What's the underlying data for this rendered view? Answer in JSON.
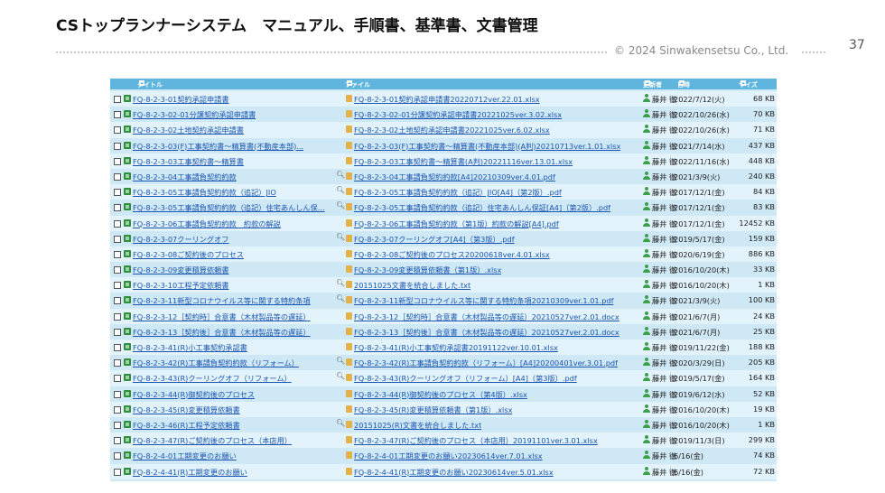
{
  "slide": {
    "title": "CSトップランナーシステム　マニュアル、手順書、基準書、文書管理",
    "copyright": "© 2024 Sinwakensetsu Co., Ltd.",
    "page_number": "37"
  },
  "table": {
    "headers": {
      "title": "タイトル",
      "file": "ファイル",
      "updater": "更新者",
      "date": "日時",
      "size": "サイズ"
    },
    "rows": [
      {
        "title": "FQ-8-2-3-01契約承認申請書",
        "file": "FQ-8-2-3-01契約承認申請書20220712ver.22.01.xlsx",
        "user": "藤井 徹",
        "date": "2022/7/12(火)",
        "size": "68 KB",
        "preview": false
      },
      {
        "title": "FQ-8-2-3-02-01分譲契約承認申請書",
        "file": "FQ-8-2-3-02-01分譲契約承認申請書20221025ver.3.02.xlsx",
        "user": "藤井 徹",
        "date": "2022/10/26(水)",
        "size": "70 KB",
        "preview": false
      },
      {
        "title": "FQ-8-2-3-02土地契約承認申請書",
        "file": "FQ-8-2-3-02土地契約承認申請書20221025ver.6.02.xlsx",
        "user": "藤井 徹",
        "date": "2022/10/26(水)",
        "size": "71 KB",
        "preview": false
      },
      {
        "title": "FQ-8-2-3-03(F)工事契約書～精算書(不動産本部)...",
        "file": "FQ-8-2-3-03(F)工事契約書～精算書(不動産本部)(A判)20210713ver.1.01.xlsx",
        "user": "藤井 徹",
        "date": "2021/7/14(水)",
        "size": "437 KB",
        "preview": false
      },
      {
        "title": "FQ-8-2-3-03工事契約書～精算書",
        "file": "FQ-8-2-3-03工事契約書～精算書(A判)20221116ver.13.01.xlsx",
        "user": "藤井 徹",
        "date": "2022/11/16(水)",
        "size": "448 KB",
        "preview": false
      },
      {
        "title": "FQ-8-2-3-04工事請負契約約款",
        "file": "FQ-8-2-3-04工事請負契約約款[A4]20210309ver.4.01.pdf",
        "user": "藤井 徹",
        "date": "2021/3/9(火)",
        "size": "240 KB",
        "preview": true
      },
      {
        "title": "FQ-8-2-3-05工事請負契約約款（追記）JIO",
        "file": "FQ-8-2-3-05工事請負契約約款（追記）JIO[A4]（第2版）.pdf",
        "user": "藤井 徹",
        "date": "2017/12/1(金)",
        "size": "84 KB",
        "preview": true
      },
      {
        "title": "FQ-8-2-3-05工事請負契約約款（追記）住宅あんしん保...",
        "file": "FQ-8-2-3-05工事請負契約約款（追記）住宅あんしん保証[A4]（第2版）.pdf",
        "user": "藤井 徹",
        "date": "2017/12/1(金)",
        "size": "83 KB",
        "preview": true
      },
      {
        "title": "FQ-8-2-3-06工事請負契約約款　約款の解説",
        "file": "FQ-8-2-3-06工事請負契約約款（第1版）約款の解説[A4].pdf",
        "user": "藤井 徹",
        "date": "2017/12/1(金)",
        "size": "12452 KB",
        "preview": false
      },
      {
        "title": "FQ-8-2-3-07クーリングオフ",
        "file": "FQ-8-2-3-07クーリングオフ[A4]（第3版）.pdf",
        "user": "藤井 徹",
        "date": "2019/5/17(金)",
        "size": "159 KB",
        "preview": true
      },
      {
        "title": "FQ-8-2-3-08ご契約後のプロセス",
        "file": "FQ-8-2-3-08ご契約後のプロセス20200618ver.4.01.xlsx",
        "user": "藤井 徹",
        "date": "2020/6/19(金)",
        "size": "886 KB",
        "preview": false
      },
      {
        "title": "FQ-8-2-3-09変更積算依頼書",
        "file": "FQ-8-2-3-09変更積算依頼書（第1版）.xlsx",
        "user": "藤井 徹",
        "date": "2016/10/20(木)",
        "size": "33 KB",
        "preview": false
      },
      {
        "title": "FQ-8-2-3-10工程予定依頼書",
        "file": "20151025文書を統合しました.txt",
        "user": "藤井 徹",
        "date": "2016/10/20(木)",
        "size": "1 KB",
        "preview": true
      },
      {
        "title": "FQ-8-2-3-11新型コロナウイルス等に関する特約条項",
        "file": "FQ-8-2-3-11新型コロナウイルス等に関する特約条項20210309ver.1.01.pdf",
        "user": "藤井 徹",
        "date": "2021/3/9(火)",
        "size": "100 KB",
        "preview": true
      },
      {
        "title": "FQ-8-2-3-12［契約時］合意書（木材製品等の遅延）",
        "file": "FQ-8-2-3-12［契約時］合意書（木材製品等の遅延）20210527ver.2.01.docx",
        "user": "藤井 徹",
        "date": "2021/6/7(月)",
        "size": "24 KB",
        "preview": false
      },
      {
        "title": "FQ-8-2-3-13［契約後］合意書（木材製品等の遅延）",
        "file": "FQ-8-2-3-13［契約後］合意書（木材製品等の遅延）20210527ver.2.01.docx",
        "user": "藤井 徹",
        "date": "2021/6/7(月)",
        "size": "25 KB",
        "preview": false
      },
      {
        "title": "FQ-8-2-3-41(R)小工事契約承認書",
        "file": "FQ-8-2-3-41(R)小工事契約承認書20191122ver.10.01.xlsx",
        "user": "藤井 徹",
        "date": "2019/11/22(金)",
        "size": "188 KB",
        "preview": false
      },
      {
        "title": "FQ-8-2-3-42(R)工事請負契約約款（リフォーム）",
        "file": "FQ-8-2-3-42(R)工事請負契約約款（リフォーム）[A4]20200401ver.3.01.pdf",
        "user": "藤井 徹",
        "date": "2020/3/29(日)",
        "size": "205 KB",
        "preview": true
      },
      {
        "title": "FQ-8-2-3-43(R)クーリングオフ（リフォーム）",
        "file": "FQ-8-2-3-43(R)クーリングオフ（リフォーム）[A4]（第3版）.pdf",
        "user": "藤井 徹",
        "date": "2019/5/17(金)",
        "size": "164 KB",
        "preview": true
      },
      {
        "title": "FQ-8-2-3-44(R)御契約後のプロセス",
        "file": "FQ-8-2-3-44(R)御契約後のプロセス（第4版）.xlsx",
        "user": "藤井 徹",
        "date": "2019/6/12(水)",
        "size": "52 KB",
        "preview": false
      },
      {
        "title": "FQ-8-2-3-45(R)変更積算依頼書",
        "file": "FQ-8-2-3-45(R)変更積算依頼書（第1版）.xlsx",
        "user": "藤井 徹",
        "date": "2016/10/20(木)",
        "size": "19 KB",
        "preview": false
      },
      {
        "title": "FQ-8-2-3-46(R)工程予定依頼書",
        "file": "20151025(R)文書を統合しました.txt",
        "user": "藤井 徹",
        "date": "2016/10/20(木)",
        "size": "1 KB",
        "preview": true
      },
      {
        "title": "FQ-8-2-3-47(R)ご契約後のプロセス（本店用）",
        "file": "FQ-8-2-3-47(R)ご契約後のプロセス（本店用）20191101ver.3.01.xlsx",
        "user": "藤井 徹",
        "date": "2019/11/3(日)",
        "size": "299 KB",
        "preview": false
      },
      {
        "title": "FQ-8-2-4-01工期変更のお願い",
        "file": "FQ-8-2-4-01工期変更のお願い20230614ver.7.01.xlsx",
        "user": "藤井 徹",
        "date": "6/16(金)",
        "size": "74 KB",
        "preview": false
      },
      {
        "title": "FQ-8-2-4-41(R)工期変更のお願い",
        "file": "FQ-8-2-4-41(R)工期変更のお願い20230614ver.5.01.xlsx",
        "user": "藤井 徹",
        "date": "6/16(金)",
        "size": "72 KB",
        "preview": false
      }
    ]
  }
}
